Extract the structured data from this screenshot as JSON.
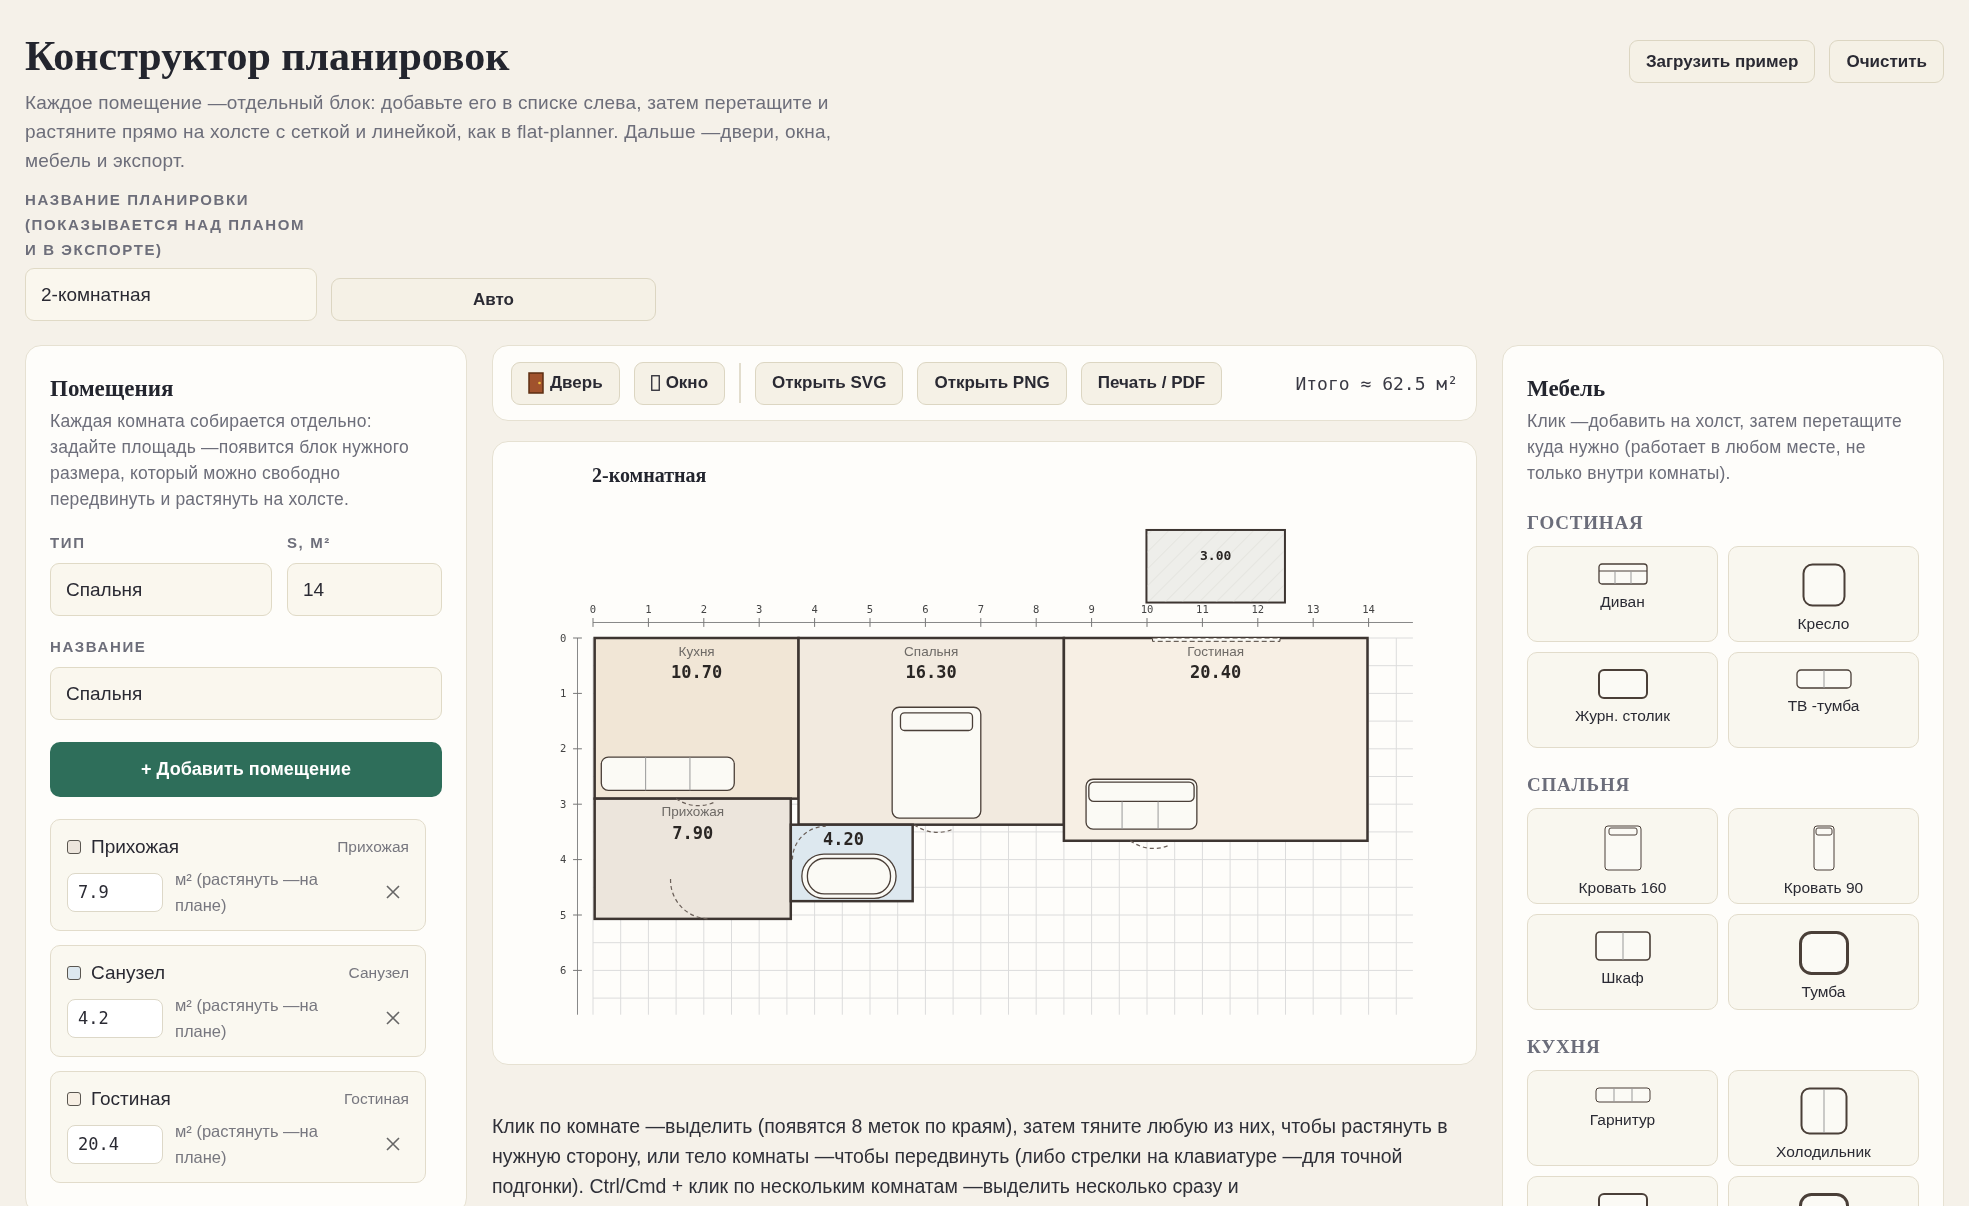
{
  "header": {
    "title": "Конструктор планировок",
    "description": "Каждое помещение —отдельный блок: добавьте его в списке слева, затем перетащите и растяните прямо на холсте с сеткой и линейкой, как в flat-planner. Дальше —двери, окна, мебель и экспорт.",
    "name_label": "НАЗВАНИЕ ПЛАНИРОВКИ (ПОКАЗЫВАЕТСЯ НАД ПЛАНОМ И В ЭКСПОРТЕ)",
    "name_value": "2-комнатная",
    "auto_button": "Авто",
    "actions": [
      "Загрузить пример",
      "Очистить"
    ]
  },
  "rooms_panel": {
    "title": "Помещения",
    "description": "Каждая комната собирается отдельно: задайте площадь —появится блок нужного размера, который можно свободно передвинуть и растянуть на холсте.",
    "type_label": "ТИП",
    "type_value": "Спальня",
    "area_label": "S, М²",
    "area_value": "14",
    "name_label": "НАЗВАНИЕ",
    "name_value": "Спальня",
    "add_button": "+ Добавить помещение",
    "items": [
      {
        "name": "Прихожая",
        "type": "Прихожая",
        "area": "7.9",
        "unit": "м² (растянуть —на плане)",
        "color": "#ece5dc"
      },
      {
        "name": "Санузел",
        "type": "Санузел",
        "area": "4.2",
        "unit": "м² (растянуть —на плане)",
        "color": "#dde8ef"
      },
      {
        "name": "Гостиная",
        "type": "Гостиная",
        "area": "20.4",
        "unit": "м² (растянуть —на плане)",
        "color": "#f7efe4"
      }
    ]
  },
  "toolbar": {
    "insert": [
      {
        "label": "Дверь",
        "kind": "door"
      },
      {
        "label": "Окно",
        "kind": "window"
      }
    ],
    "export": [
      "Открыть SVG",
      "Открыть PNG",
      "Печать / PDF"
    ],
    "total": "Итого ≈ 62.5 м²"
  },
  "plan": {
    "title": "2-комнатная",
    "x_ticks": [
      "0",
      "1",
      "2",
      "3",
      "4",
      "5",
      "6",
      "7",
      "8",
      "9",
      "10",
      "11",
      "12",
      "13",
      "14"
    ],
    "y_ticks": [
      "0",
      "1",
      "2",
      "3",
      "4",
      "5",
      "6"
    ],
    "rooms": [
      {
        "kind": "room",
        "name": "Кухня",
        "area": "10.70",
        "color": "#f1e6d6"
      },
      {
        "kind": "room",
        "name": "Спальня",
        "area": "16.30",
        "color": "#f2eadf"
      },
      {
        "kind": "room",
        "name": "Гостиная",
        "area": "20.40",
        "color": "#f7efe4"
      },
      {
        "kind": "room",
        "name": "Прихожая",
        "area": "7.90",
        "color": "#ece5dc"
      },
      {
        "kind": "room",
        "area": "4.20",
        "color": "#dde8ef"
      },
      {
        "kind": "balcony",
        "area": "3.00",
        "color": "#eeeeea"
      }
    ]
  },
  "hint": "Клик по комнате —выделить (появятся 8 меток по краям), затем тяните любую из них, чтобы растянуть в нужную сторону, или тело комнаты —чтобы передвинуть (либо стрелки на клавиатуре —для точной подгонки). Ctrl/Cmd + клик по нескольким комнатам —выделить несколько сразу и",
  "furniture_panel": {
    "title": "Мебель",
    "description": "Клик —добавить на холст, затем перетащите куда нужно (работает в любом месте, не только внутри комнаты).",
    "sections": [
      {
        "title": "ГОСТИНАЯ",
        "items": [
          {
            "label": "Диван",
            "kind": "sofa"
          },
          {
            "label": "Кресло",
            "kind": "armchair"
          },
          {
            "label": "Журн. столик",
            "kind": "table"
          },
          {
            "label": "ТВ -тумба",
            "kind": "tv"
          }
        ]
      },
      {
        "title": "СПАЛЬНЯ",
        "items": [
          {
            "label": "Кровать 160",
            "kind": "bed"
          },
          {
            "label": "Кровать 90",
            "kind": "bed_single"
          },
          {
            "label": "Шкаф",
            "kind": "wardrobe"
          },
          {
            "label": "Тумба",
            "kind": "nightstand"
          }
        ]
      },
      {
        "title": "КУХНЯ",
        "items": [
          {
            "label": "Гарнитур",
            "kind": "kitchen"
          },
          {
            "label": "Холодильник",
            "kind": "fridge"
          },
          {
            "kind": "table"
          },
          {
            "kind": "nightstand"
          }
        ]
      }
    ]
  }
}
